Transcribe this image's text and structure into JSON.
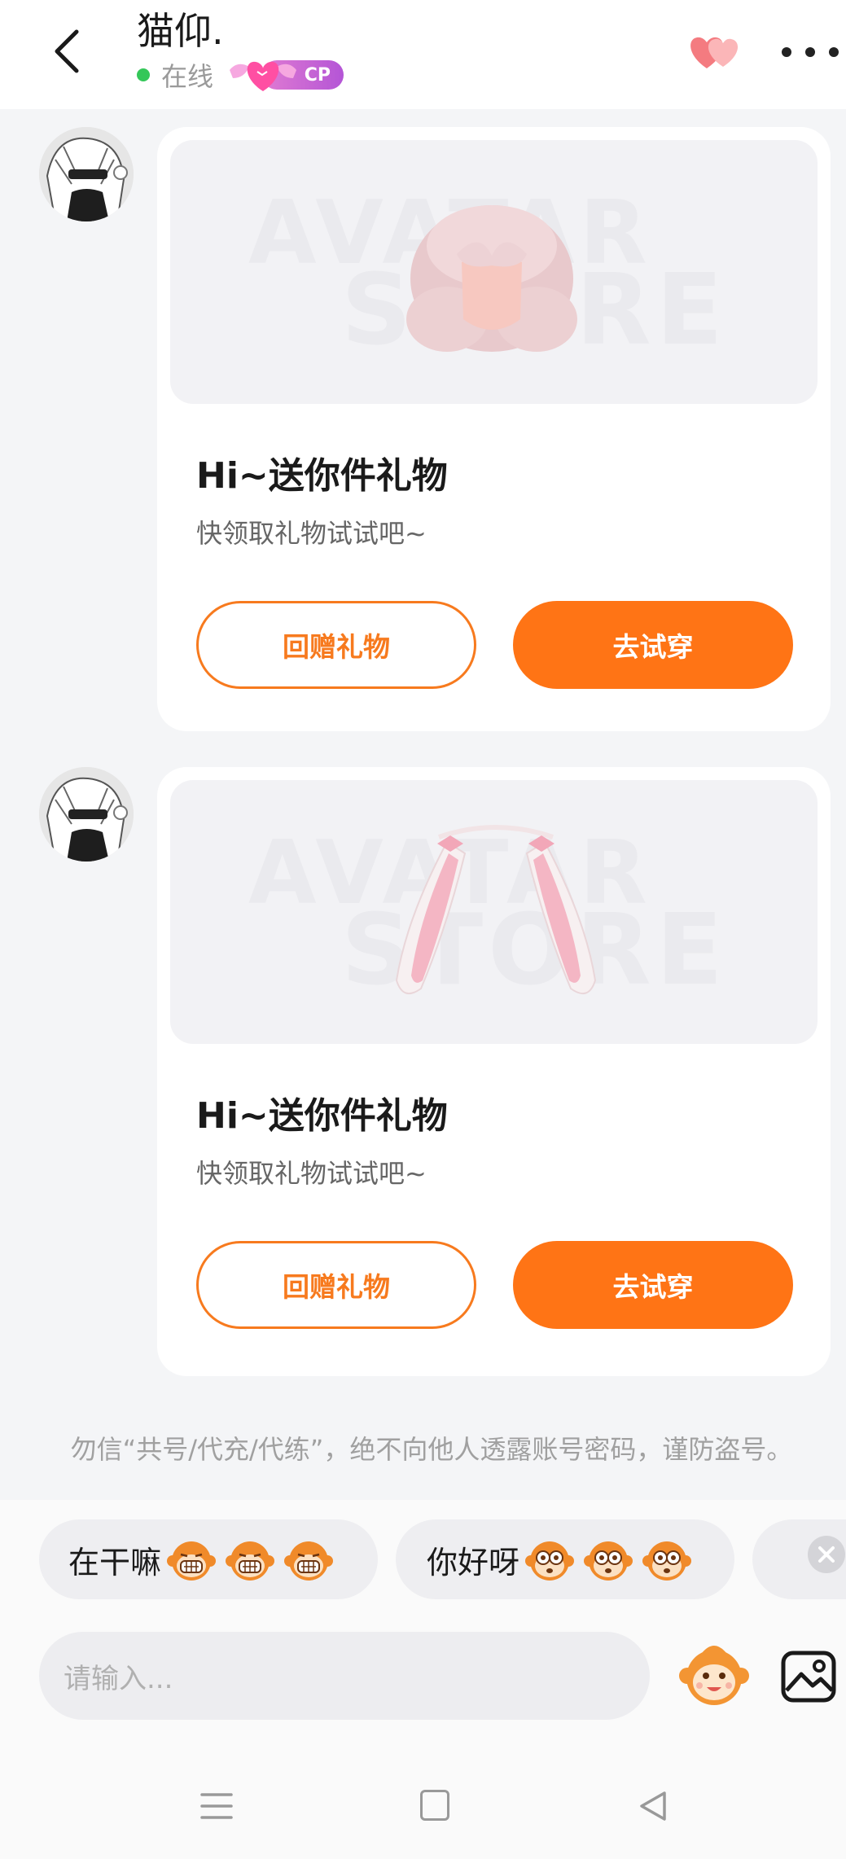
{
  "header": {
    "title": "猫仰.",
    "status": "在线",
    "badge": "CP"
  },
  "messages": [
    {
      "watermark_top": "AVATAR",
      "watermark_bottom": "STORE",
      "title": "Hi~送你件礼物",
      "subtitle": "快领取礼物试试吧~",
      "return_gift_label": "回赠礼物",
      "try_on_label": "去试穿"
    },
    {
      "watermark_top": "AVATAR",
      "watermark_bottom": "STORE",
      "title": "Hi~送你件礼物",
      "subtitle": "快领取礼物试试吧~",
      "return_gift_label": "回赠礼物",
      "try_on_label": "去试穿"
    }
  ],
  "notice": "勿信“共号/代充/代练”，绝不向他人透露账号密码，谨防盗号。",
  "quick_replies": [
    {
      "text": "在干嘛"
    },
    {
      "text": "你好呀"
    }
  ],
  "input": {
    "placeholder": "请输入..."
  },
  "colors": {
    "accent": "#ff7415",
    "online": "#34c759",
    "cp_badge": "#c060d8"
  }
}
